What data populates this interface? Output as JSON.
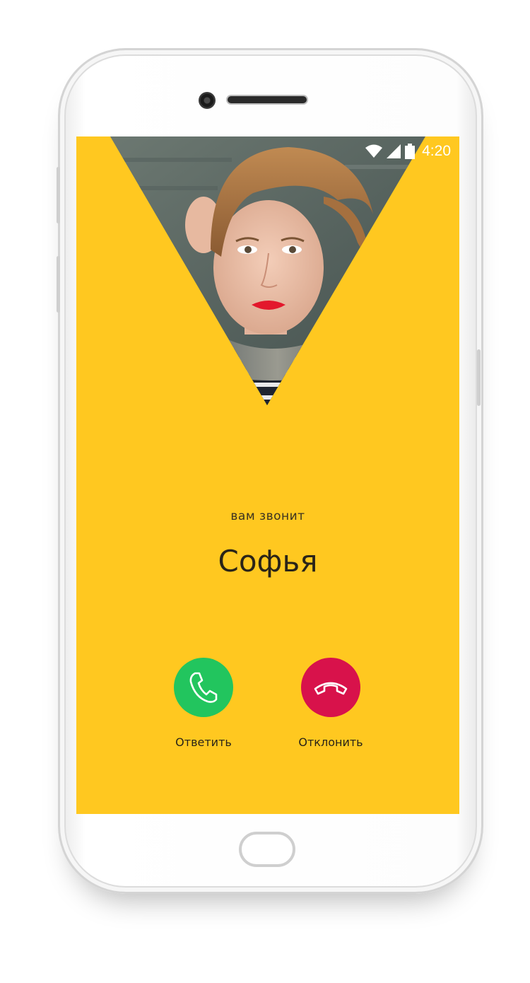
{
  "status_bar": {
    "time": "4:20",
    "icons": [
      "wifi-icon",
      "cell-signal-icon",
      "battery-icon"
    ]
  },
  "incoming_call": {
    "caption": "вам звонит",
    "caller_name": "Софья"
  },
  "actions": {
    "answer_label": "Ответить",
    "decline_label": "Отклонить"
  },
  "colors": {
    "background": "#ffc820",
    "answer": "#22c55e",
    "decline": "#d8124b",
    "text": "#2a2418"
  }
}
